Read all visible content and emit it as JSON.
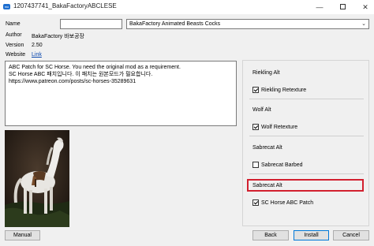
{
  "window": {
    "app_icon": "mo",
    "title": "1207437741_BakaFactoryABCLESE",
    "icons": {
      "minimize": "minimize-icon",
      "maximize": "maximize-icon",
      "close": "close-icon"
    }
  },
  "header": {
    "name_label": "Name",
    "name_value": "",
    "selected_option": "BakaFactory Animated Beasts Cocks"
  },
  "info": {
    "author_label": "Author",
    "author_value": "BakaFactory 바보공장",
    "version_label": "Version",
    "version_value": "2.50",
    "website_label": "Website",
    "website_link": "Link"
  },
  "description": {
    "lines": [
      "ABC Patch for SC Horse. You need the original mod as a requirement.",
      "SC Horse ABC 패치입니다. 이 패치는 원본모드가 필요합니다.",
      "https://www.patreon.com/posts/sc-horses-35289631"
    ]
  },
  "options_panel": {
    "groups": [
      {
        "title": "Riekling Alt",
        "option": "Riekling Retexture",
        "checked": true
      },
      {
        "title": "Wolf Alt",
        "option": "Wolf Retexture",
        "checked": true
      },
      {
        "title": "Sabrecat Alt",
        "option": "Sabrecat Barbed",
        "checked": false
      },
      {
        "title": "Sabrecat Alt",
        "option": "SC Horse ABC Patch",
        "checked": true
      }
    ],
    "highlight_color": "#d2202f"
  },
  "buttons": {
    "manual": "Manual",
    "back": "Back",
    "install": "Install",
    "cancel": "Cancel"
  }
}
